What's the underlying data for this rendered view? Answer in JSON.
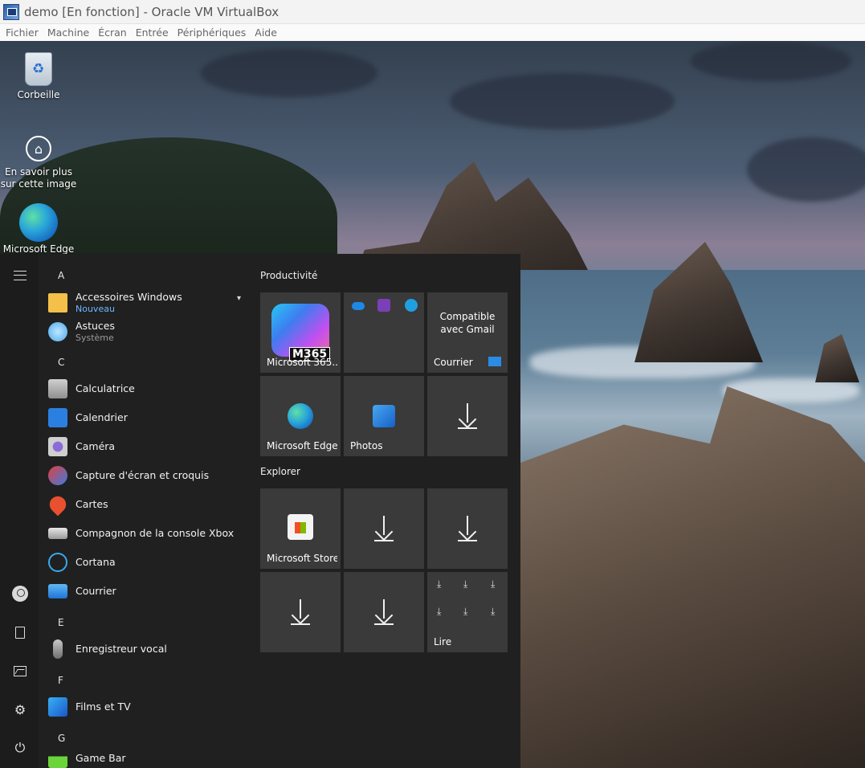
{
  "window": {
    "title": "demo [En fonction] - Oracle VM VirtualBox"
  },
  "menu": [
    "Fichier",
    "Machine",
    "Écran",
    "Entrée",
    "Périphériques",
    "Aide"
  ],
  "desktop_icons": [
    {
      "label": "Corbeille",
      "icon": "recycle-bin-icon"
    },
    {
      "label": "En savoir plus sur cette image",
      "icon": "learn-about-image-icon"
    },
    {
      "label": "Microsoft Edge",
      "icon": "edge-icon"
    }
  ],
  "start_menu": {
    "rail": [
      "menu-icon",
      "user-icon",
      "documents-icon",
      "pictures-icon",
      "settings-icon",
      "power-icon"
    ],
    "letters": [
      "A",
      "C",
      "E",
      "F",
      "G"
    ],
    "apps": [
      {
        "name": "Accessoires Windows",
        "sub": "Nouveau",
        "sub_color": "#6cb8ff",
        "icon": "folder-icon"
      },
      {
        "name": "Astuces",
        "sub": "Système",
        "sub_color": "#9a9a9a",
        "icon": "lightbulb-icon"
      },
      {
        "name": "Calculatrice",
        "icon": "calculator-icon"
      },
      {
        "name": "Calendrier",
        "icon": "calendar-icon"
      },
      {
        "name": "Caméra",
        "icon": "camera-icon"
      },
      {
        "name": "Capture d'écran et croquis",
        "icon": "snip-sketch-icon"
      },
      {
        "name": "Cartes",
        "icon": "maps-icon"
      },
      {
        "name": "Compagnon de la console Xbox",
        "icon": "xbox-console-icon"
      },
      {
        "name": "Cortana",
        "icon": "cortana-icon"
      },
      {
        "name": "Courrier",
        "icon": "mail-icon"
      },
      {
        "name": "Enregistreur vocal",
        "icon": "voice-recorder-icon"
      },
      {
        "name": "Films et TV",
        "icon": "films-tv-icon"
      },
      {
        "name": "Game Bar",
        "icon": "game-bar-icon"
      }
    ],
    "groups": [
      {
        "title": "Productivité"
      },
      {
        "title": "Explorer"
      }
    ],
    "tiles": {
      "m365_label": "Microsoft 365...",
      "m365_badge": "M365",
      "mail_top": "Compatible avec Gmail",
      "mail_label": "Courrier",
      "edge_label": "Microsoft Edge",
      "photos_label": "Photos",
      "store_label": "Microsoft Store",
      "read_label": "Lire"
    }
  }
}
